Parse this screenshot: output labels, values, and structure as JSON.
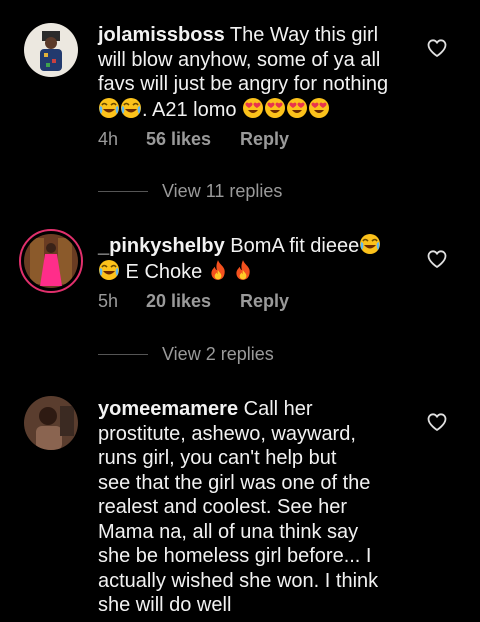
{
  "comments": [
    {
      "username": "jolamissboss",
      "text_line1": " The Way this girl",
      "text_line2": "will blow anyhow, some of ya all",
      "text_line3": "favs will just be angry for nothing",
      "text_line4": ". A21 lomo ",
      "emojis_before": [
        "laughing-tears-emoji",
        "laughing-tears-emoji"
      ],
      "emojis_after": [
        "heart-eyes-emoji",
        "heart-eyes-emoji",
        "heart-eyes-emoji",
        "heart-eyes-emoji"
      ],
      "time": "4h",
      "likes": "56 likes",
      "reply": "Reply",
      "view_replies": "View 11 replies"
    },
    {
      "username": "_pinkyshelby",
      "text_line1": " BomA fit dieee",
      "text_line2": " E Choke ",
      "time": "5h",
      "likes": "20 likes",
      "reply": "Reply",
      "view_replies": "View 2 replies"
    },
    {
      "username": "yomeemamere",
      "text_line1": " Call her",
      "lines": [
        "prostitute, ashewo, wayward,",
        "runs girl, you can't help but",
        "see that the girl was one of the",
        "realest and coolest. See her",
        "Mama na, all of una think say",
        "she be homeless girl before... I",
        "actually wished she won. I think",
        "she will do well"
      ]
    }
  ],
  "colors": {
    "background": "#000000",
    "text": "#f2f2f2",
    "muted": "#9a9a9a",
    "story_ring": "#e1306c"
  }
}
